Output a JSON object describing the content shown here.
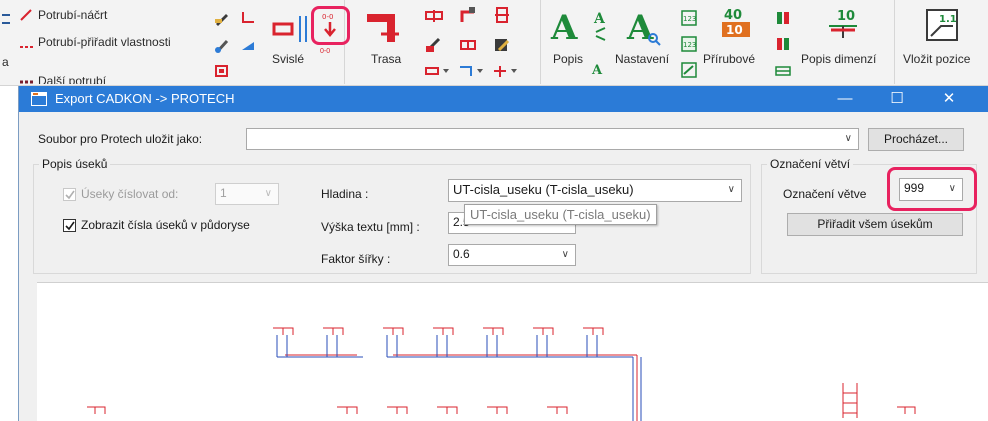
{
  "ribbon": {
    "left_items": [
      "Potrubí-náčrt",
      "Potrubí-přiřadit vlastnosti",
      "Další potrubí"
    ],
    "edge_label": "a",
    "buttons": {
      "svisle": "Svislé",
      "trasa": "Trasa",
      "popis": "Popis",
      "nastaveni": "Nastavení",
      "prirubove": "Přírubové",
      "popis_dimenzi": "Popis dimenzí",
      "vlozit_pozice": "Vložit pozice"
    },
    "icon_text": {
      "n40": "40",
      "n10": "10",
      "n10b": "10",
      "n11": "1.1",
      "n123": "123",
      "n00": "0-0"
    },
    "accent_colors": {
      "highlight": "#e8225f",
      "green": "#1e8a3a",
      "red": "#d9232e"
    }
  },
  "dialog": {
    "title": "Export CADKON -> PROTECH",
    "title_bar_color": "#2b7bd7",
    "save_as": {
      "label": "Soubor pro Protech uložit jako:",
      "value": "",
      "browse_button": "Procházet..."
    },
    "segments_group": {
      "title": "Popis úseků",
      "number_from": {
        "label": "Úseky číslovat od:",
        "value": "1",
        "checked": true,
        "disabled": true
      },
      "show_numbers": {
        "label": "Zobrazit čísla úseků v půdoryse",
        "checked": true
      },
      "layer": {
        "label": "Hladina :",
        "value": "UT-cisla_useku (T-cisla_useku)"
      },
      "text_height": {
        "label": "Výška textu [mm] :",
        "value": "2.5"
      },
      "width_factor": {
        "label": "Faktor šířky :",
        "value": "0.6"
      }
    },
    "tooltip": "UT-cisla_useku (T-cisla_useku)",
    "branch_group": {
      "title": "Označení větví",
      "label": "Označení větve",
      "value": "999",
      "assign_button": "Přiřadit všem úsekům"
    }
  }
}
